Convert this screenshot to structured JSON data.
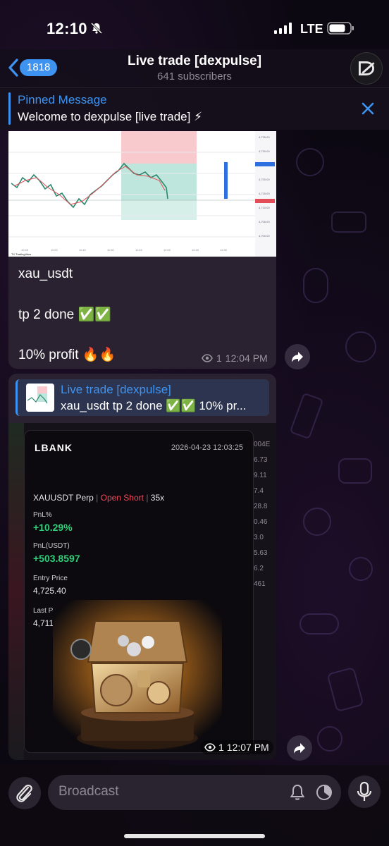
{
  "status_bar": {
    "time": "12:10",
    "network": "LTE"
  },
  "header": {
    "back_count": "1818",
    "title": "Live trade [dexpulse]",
    "subtitle": "641 subscribers"
  },
  "pinned": {
    "title": "Pinned Message",
    "text": "Welcome to  dexpulse [live trade] ⚡"
  },
  "messages": [
    {
      "lines": [
        "xau_usdt",
        "tp 2 done ✅✅",
        "10% profit 🔥🔥"
      ],
      "views": "1",
      "time": "12:04 PM"
    },
    {
      "reply": {
        "title": "Live trade [dexpulse]",
        "text": "xau_usdt tp 2 done ✅✅ 10% pr..."
      },
      "card": {
        "logo": "LBANK",
        "date": "2026-04-23 12:03:25",
        "pair": "XAUUSDT Perp",
        "position": "Open Short",
        "leverage": "35x",
        "pnl_pct_label": "PnL%",
        "pnl_pct": "+10.29%",
        "pnl_usdt_label": "PnL(USDT)",
        "pnl_usdt": "+503.8597",
        "entry_label": "Entry Price",
        "entry": "4,725.40",
        "last_label": "Last Price",
        "last": "4,711.51"
      },
      "side_numbers": [
        "004E",
        "6.73",
        "9.11",
        "7.4",
        "28.8",
        "0.46",
        "3.0",
        "5.63",
        "6.2",
        "461"
      ],
      "views": "1",
      "time": "12:07 PM"
    }
  ],
  "input": {
    "placeholder": "Broadcast"
  },
  "colors": {
    "accent": "#3e93f0",
    "profit": "#2ed07a",
    "short": "#ef4a5e"
  }
}
